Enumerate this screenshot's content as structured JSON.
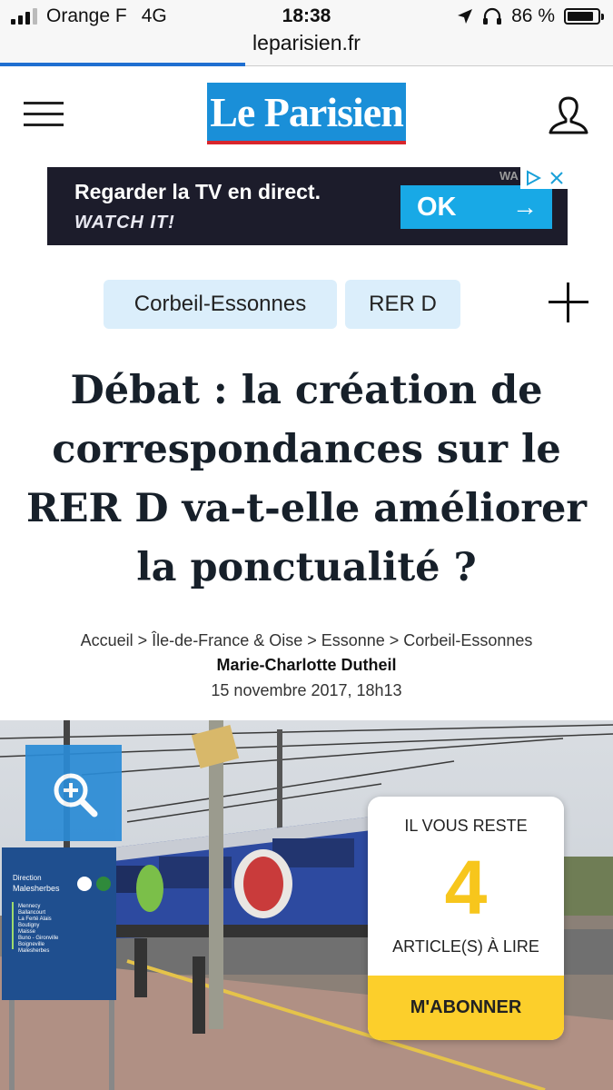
{
  "status_bar": {
    "carrier": "Orange F",
    "network": "4G",
    "time": "18:38",
    "battery": "86 %",
    "battery_level": 0.86
  },
  "browser": {
    "url": "leparisien.fr",
    "load_progress": 0.4
  },
  "header": {
    "logo_text": "Le Parisien",
    "brand_color": "#1a8fd8"
  },
  "ad": {
    "text": "Regarder la TV en direct.",
    "brand": "WATCH IT!",
    "cta": "OK",
    "cta_arrow": "→"
  },
  "tags": [
    "Corbeil-Essonnes",
    "RER D"
  ],
  "article": {
    "title": "Débat : la création de correspondances sur le RER D va-t-elle améliorer la ponctualité ?",
    "breadcrumb": "Accueil > Île-de-France & Oise > Essonne > Corbeil-Essonnes",
    "author": "Marie-Charlotte Dutheil",
    "date": "15 novembre 2017, 18h13"
  },
  "photo": {
    "sign_direction": "Direction",
    "sign_destination": "Malesherbes",
    "sign_stations": [
      "Mennecy",
      "Ballancourt",
      "La Ferté Alais",
      "Boutigny",
      "Maisse",
      "Buno - Gironville",
      "Boigneville",
      "Malesherbes"
    ]
  },
  "paywall": {
    "line1": "IL VOUS RESTE",
    "count": "4",
    "line2": "ARTICLE(S) À LIRE",
    "button": "M'ABONNER",
    "accent": "#fccf2b"
  }
}
